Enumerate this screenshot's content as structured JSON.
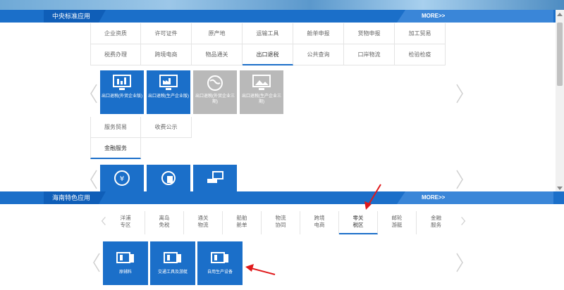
{
  "section1": {
    "title": "中央标准应用",
    "more": "MORE>>",
    "row1": [
      "企业资质",
      "许可证件",
      "原产地",
      "运输工具",
      "舱单申报",
      "货物申报",
      "加工贸易"
    ],
    "row2": [
      "税费办理",
      "跨境电商",
      "物品通关",
      "出口退税",
      "公共查询",
      "口岸物流",
      "检验检疫"
    ],
    "active_tab": "出口退税",
    "tiles": [
      {
        "label": "出口退税(外贸企业版)",
        "style": "blue"
      },
      {
        "label": "出口退税(生产企业版)",
        "style": "blue"
      },
      {
        "label": "出口退税(外贸企业三期)",
        "style": "gray"
      },
      {
        "label": "出口退税(生产企业三期)",
        "style": "gray"
      }
    ],
    "row3": [
      "服务贸易",
      "收费公示"
    ],
    "row4": [
      "金融服务"
    ]
  },
  "section2": {
    "title": "海南特色应用",
    "more": "MORE>>",
    "tabs": [
      {
        "l1": "洋浦",
        "l2": "专区"
      },
      {
        "l1": "离岛",
        "l2": "免税"
      },
      {
        "l1": "通关",
        "l2": "物流"
      },
      {
        "l1": "船舶",
        "l2": "舱单"
      },
      {
        "l1": "物流",
        "l2": "协同"
      },
      {
        "l1": "跨境",
        "l2": "电商"
      },
      {
        "l1": "零关",
        "l2": "税区"
      },
      {
        "l1": "邮轮",
        "l2": "游艇"
      },
      {
        "l1": "金融",
        "l2": "服务"
      }
    ],
    "active_tab_index": 6,
    "tiles": [
      "原辅料",
      "交通工具及游艇",
      "自用生产设备"
    ]
  },
  "colors": {
    "brand_blue": "#1b6fc9",
    "annotation_red": "#e0191b"
  }
}
